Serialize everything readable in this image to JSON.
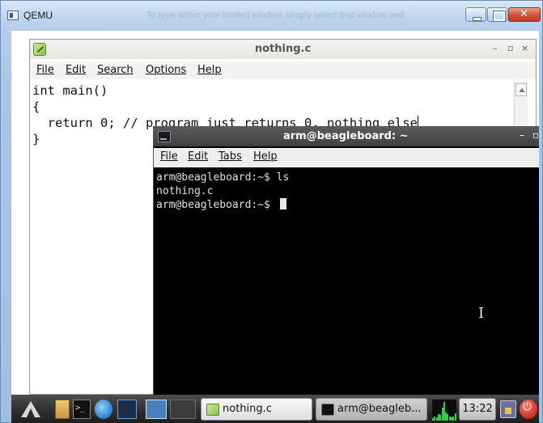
{
  "host_window": {
    "title": "QEMU",
    "ghost_text": "To type within your bolded window, simply select that window and"
  },
  "editor": {
    "title": "nothing.c",
    "menu": [
      "File",
      "Edit",
      "Search",
      "Options",
      "Help"
    ],
    "lines": [
      "int main()",
      "{",
      "  return 0; // program just returns 0, nothing else",
      "}"
    ],
    "controls": {
      "minimize": "–",
      "maximize": "▫",
      "close": "×"
    }
  },
  "terminal": {
    "title": "arm@beagleboard: ~",
    "menu": [
      "File",
      "Edit",
      "Tabs",
      "Help"
    ],
    "lines": [
      "arm@beagleboard:~$ ls",
      "nothing.c",
      "arm@beagleboard:~$ "
    ],
    "controls": {
      "minimize": "–",
      "close": "▫"
    }
  },
  "taskbar": {
    "tasks": [
      {
        "label": "nothing.c",
        "icon": "editor-icon"
      },
      {
        "label": "arm@beagleb...",
        "icon": "terminal-icon"
      }
    ],
    "clock": "13:22",
    "launchers": [
      "start-menu-icon",
      "file-manager-icon",
      "terminal-icon",
      "web-browser-icon",
      "monitor-icon",
      "desktop-switcher-icon"
    ],
    "cpu_levels": [
      0.1,
      0.2,
      0.15,
      0.3,
      0.25,
      0.6,
      0.9,
      0.4,
      0.3,
      0.2,
      0.15,
      0.2,
      0.35
    ]
  },
  "colors": {
    "terminal_bg": "#000000",
    "terminal_text": "#e0e0e0",
    "taskbar_bg": "#2c2c2c",
    "host_title_bg": "#c2d8f0"
  }
}
